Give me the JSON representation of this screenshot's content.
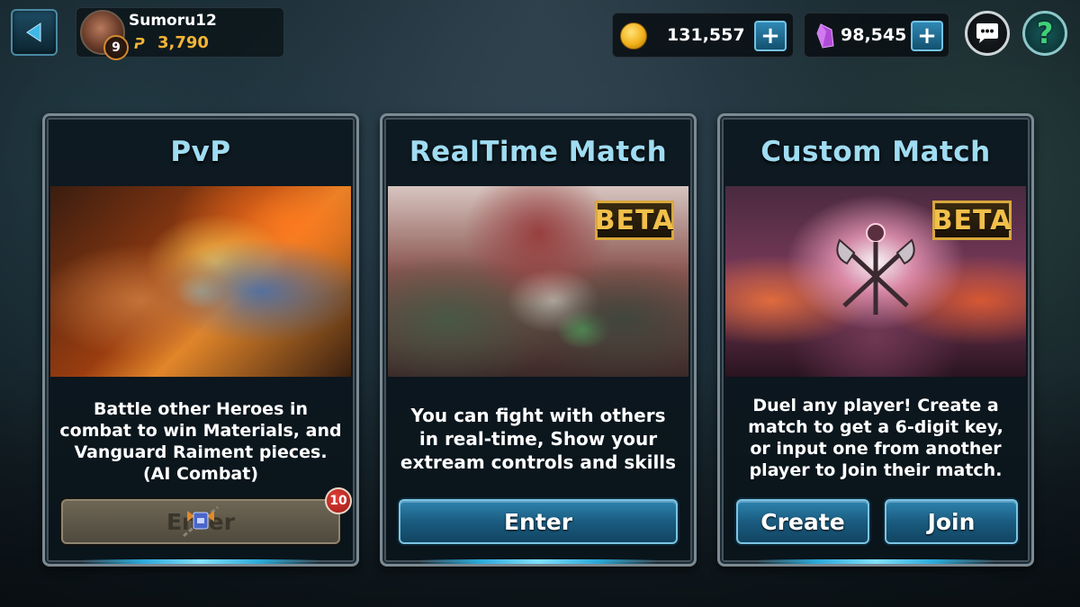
{
  "player": {
    "name": "Sumoru12",
    "level": "9",
    "points": "3,790"
  },
  "currency": {
    "coins": "131,557",
    "gems": "98,545"
  },
  "cards": {
    "pvp": {
      "title": "PvP",
      "desc": [
        "Battle other Heroes in",
        "combat to win Materials, and",
        "Vanguard Raiment pieces.",
        "(AI Combat)"
      ],
      "button": "Enter",
      "badge": "10"
    },
    "realtime": {
      "title": "RealTime Match",
      "tag": "BETA",
      "desc": [
        "You can fight with others",
        "in real-time, Show your",
        "extream controls and skills"
      ],
      "button": "Enter"
    },
    "custom": {
      "title": "Custom Match",
      "tag": "BETA",
      "desc": [
        "Duel any player! Create a",
        "match to get a 6-digit key,",
        "or input one from another",
        "player to Join their match."
      ],
      "create_button": "Create",
      "join_button": "Join"
    }
  },
  "colors": {
    "title": "#9fdcf2",
    "accent_blue": "#2e84b0",
    "gold": "#f4b534",
    "beta_gold": "#f2c04a"
  },
  "icons": {
    "back": "back-arrow-icon",
    "coin": "coin-icon",
    "gem": "gem-icon",
    "chat": "chat-icon",
    "help": "help-icon",
    "lock": "locked-chain-icon"
  }
}
